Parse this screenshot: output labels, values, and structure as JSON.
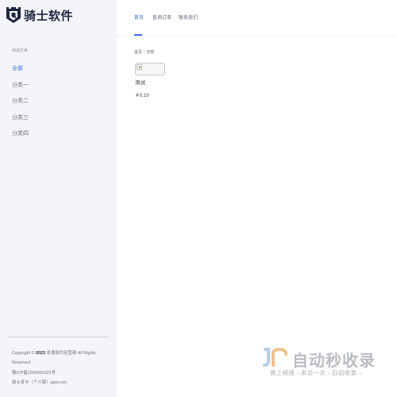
{
  "brand": {
    "name": "骑士软件",
    "logo_icon": "castle-shield-logo",
    "color": "#1c2540"
  },
  "sidebar": {
    "title": "商品栏目",
    "categories": [
      {
        "label": "全部",
        "active": true
      },
      {
        "label": "分类一",
        "active": false
      },
      {
        "label": "分类二",
        "active": false
      },
      {
        "label": "分类三",
        "active": false
      },
      {
        "label": "分类四",
        "active": false
      }
    ],
    "footer": {
      "copyright_prefix": "Copyright ©",
      "year": "2023",
      "owner": "卓逸软件经营部 All Rights Reserved",
      "icp": "豫ICP备2024064321号",
      "shop": "骑士发卡（个人版）qqss.net"
    }
  },
  "nav": {
    "tabs": [
      {
        "label": "首页",
        "active": true
      },
      {
        "label": "查询订单",
        "active": false
      },
      {
        "label": "联系我们",
        "active": false
      }
    ],
    "accent": "#3a6ef0"
  },
  "breadcrumb": {
    "home": "首页",
    "separator": "/",
    "current": "全部"
  },
  "products": [
    {
      "name": "测试",
      "price": "￥0.10",
      "image_icon": "broken-image-icon"
    }
  ],
  "watermark": {
    "title": "自动秒收录",
    "subtitle": "做上链接→来访一次→自动收录→"
  }
}
